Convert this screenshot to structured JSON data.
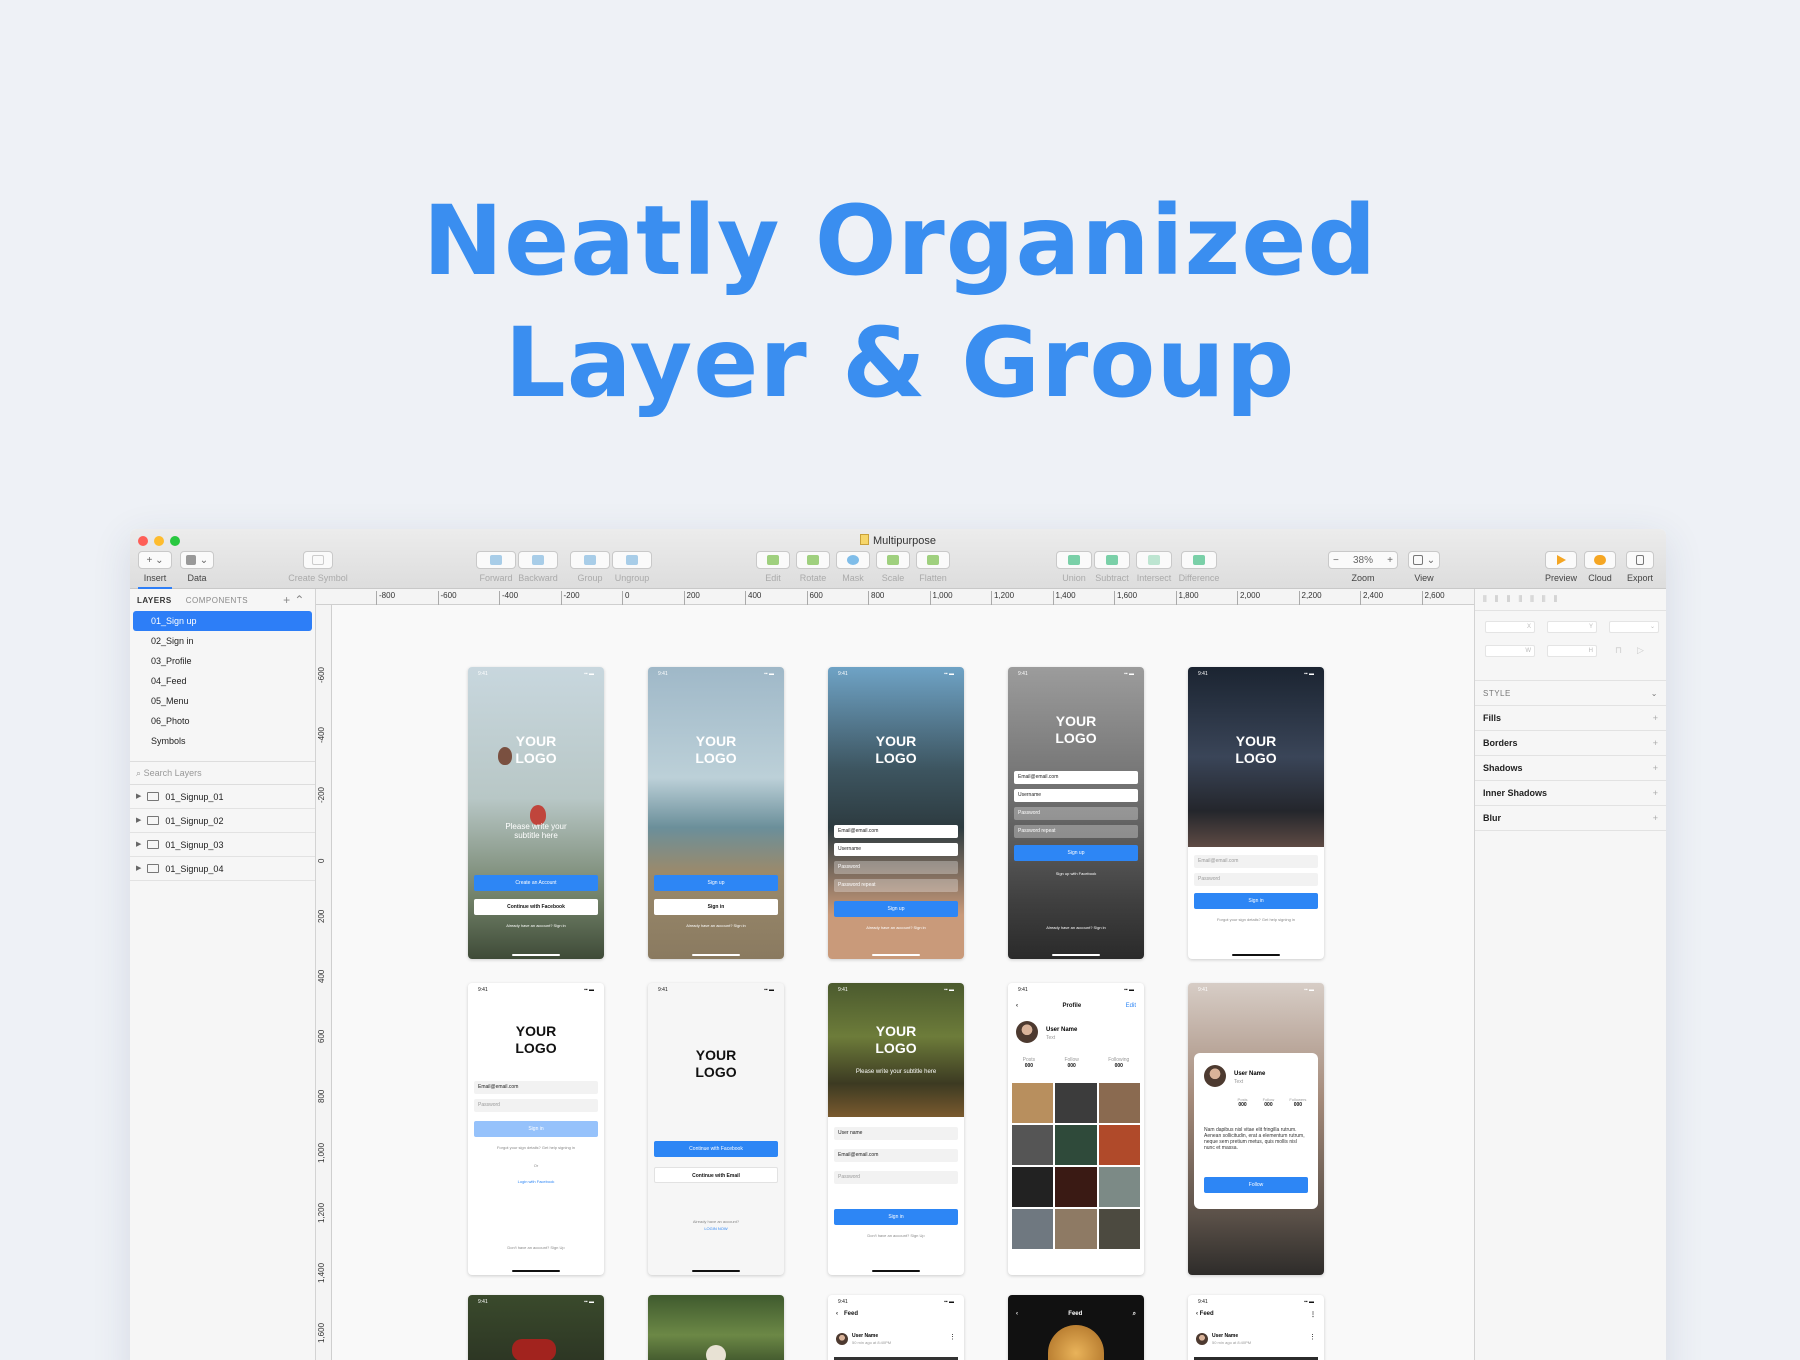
{
  "headline": {
    "line1": "Neatly Organized",
    "line2": "Layer & Group",
    "color": "#3a8ef0"
  },
  "window": {
    "title": "Multipurpose",
    "traffic_lights": [
      "#fe5f57",
      "#febc2e",
      "#28c840"
    ]
  },
  "toolbar": {
    "insert": "Insert",
    "data": "Data",
    "create_symbol": "Create Symbol",
    "forward": "Forward",
    "backward": "Backward",
    "group": "Group",
    "ungroup": "Ungroup",
    "edit": "Edit",
    "rotate": "Rotate",
    "mask": "Mask",
    "scale": "Scale",
    "flatten": "Flatten",
    "union": "Union",
    "subtract": "Subtract",
    "intersect": "Intersect",
    "difference": "Difference",
    "zoom_label": "Zoom",
    "zoom_value": "38%",
    "zoom_minus": "−",
    "zoom_plus": "+",
    "view": "View",
    "preview": "Preview",
    "cloud": "Cloud",
    "export": "Export",
    "plus_glyph": "+ ⌄",
    "dropdown_glyph": "⌄"
  },
  "left_panel": {
    "tab_layers": "LAYERS",
    "tab_components": "COMPONENTS",
    "controls": "+  ⌃",
    "pages": [
      "01_Sign up",
      "02_Sign in",
      "03_Profile",
      "04_Feed",
      "05_Menu",
      "06_Photo",
      "Symbols"
    ],
    "selected_page": "01_Sign up",
    "search_placeholder": "Search Layers",
    "layers": [
      "01_Signup_01",
      "01_Signup_02",
      "01_Signup_03",
      "01_Signup_04"
    ]
  },
  "rulers": {
    "top": [
      "-800",
      "-600",
      "-400",
      "-200",
      "0",
      "200",
      "400",
      "600",
      "800",
      "1,000",
      "1,200",
      "1,400",
      "1,600",
      "1,800",
      "2,000",
      "2,200",
      "2,400",
      "2,600"
    ],
    "left": [
      "-600",
      "-400",
      "-200",
      "0",
      "200",
      "400",
      "600",
      "800",
      "1,000",
      "1,200",
      "1,400",
      "1,600"
    ]
  },
  "inspector": {
    "style": "STYLE",
    "fills": "Fills",
    "borders": "Borders",
    "shadows": "Shadows",
    "inner_shadows": "Inner Shadows",
    "blur": "Blur",
    "plus": "+",
    "chevron": "⌄",
    "x": "X",
    "y": "Y",
    "w": "W",
    "h": "H"
  },
  "screens": {
    "time": "9:41",
    "logo": "YOUR LOGO",
    "subtitle": "Please write your subtitle here",
    "create_account": "Create an Account",
    "continue_facebook": "Continue with Facebook",
    "already": "Already have an account? Sign in",
    "sign_up": "Sign up",
    "sign_in": "Sign in",
    "email": "Email@email.com",
    "username": "Username",
    "user_name_field": "User name",
    "password": "Password",
    "password_repeat": "Password repeat",
    "signup_facebook": "Sign up with Facebook",
    "forgot": "Forgot your sign details? Get help signing in",
    "or": "Or",
    "login_facebook": "Login with Facebook",
    "dont_have": "Don't have an account? Sign Up",
    "continue_email": "Continue with Email",
    "already_login": "Already have an account?",
    "login_now": "LOGIN NOW",
    "profile": "Profile",
    "edit": "Edit",
    "user_name": "User Name",
    "text": "Text",
    "posts": "Posts",
    "follow": "Follow",
    "followers": "Followers",
    "following": "Following",
    "count": "000",
    "bio": "Nam dapibus nisl vitae elit fringilla rutrum. Aenean sollicitudin, erat a elementum rutrum, neque sem pretium metus, quis mollis nisl nunc et massa.",
    "feed": "Feed",
    "time_ago": "50 min ago at 8:40PM",
    "back": "‹",
    "dots": "⋮"
  }
}
